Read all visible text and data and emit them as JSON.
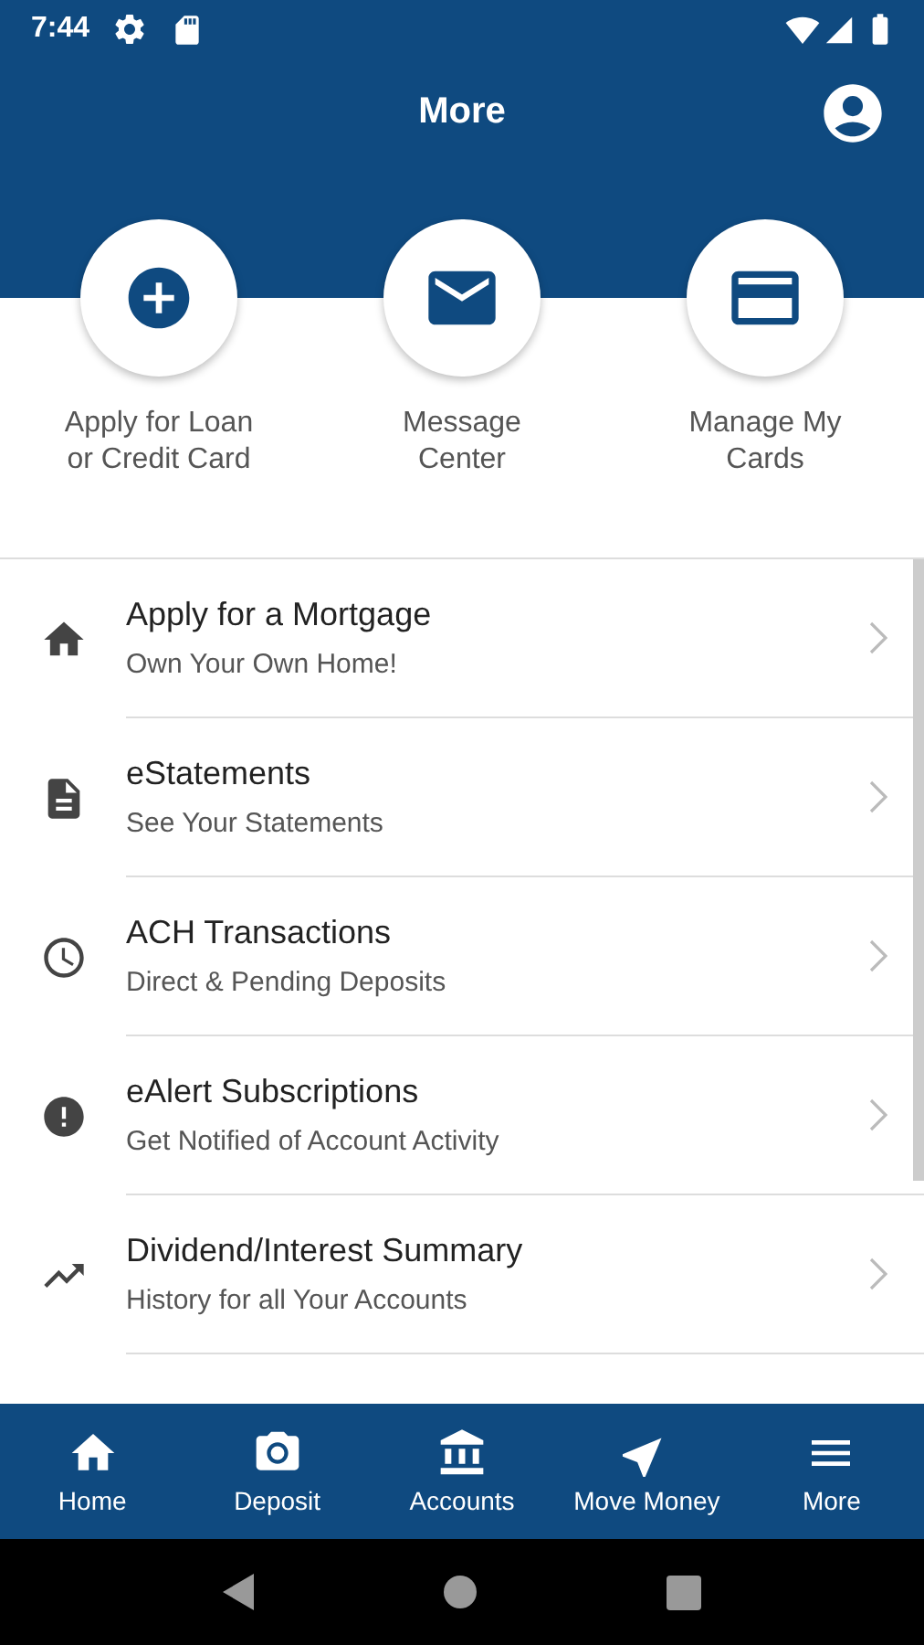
{
  "status_bar": {
    "time": "7:44"
  },
  "header": {
    "title": "More"
  },
  "quick_actions": [
    {
      "kind": "add",
      "label": "Apply for Loan or Credit Card"
    },
    {
      "kind": "mail",
      "label": "Message Center"
    },
    {
      "kind": "card",
      "label": "Manage My Cards"
    }
  ],
  "menu": [
    {
      "kind": "home",
      "title": "Apply for a Mortgage",
      "subtitle": "Own Your Own Home!"
    },
    {
      "kind": "document",
      "title": "eStatements",
      "subtitle": "See Your Statements"
    },
    {
      "kind": "clock",
      "title": "ACH Transactions",
      "subtitle": "Direct & Pending Deposits"
    },
    {
      "kind": "alert",
      "title": "eAlert Subscriptions",
      "subtitle": "Get Notified of Account Activity"
    },
    {
      "kind": "trend",
      "title": "Dividend/Interest Summary",
      "subtitle": "History for all Your Accounts"
    }
  ],
  "bottom_nav": [
    {
      "kind": "home",
      "label": "Home"
    },
    {
      "kind": "camera",
      "label": "Deposit"
    },
    {
      "kind": "bank",
      "label": "Accounts"
    },
    {
      "kind": "send",
      "label": "Move Money"
    },
    {
      "kind": "menu",
      "label": "More"
    }
  ]
}
